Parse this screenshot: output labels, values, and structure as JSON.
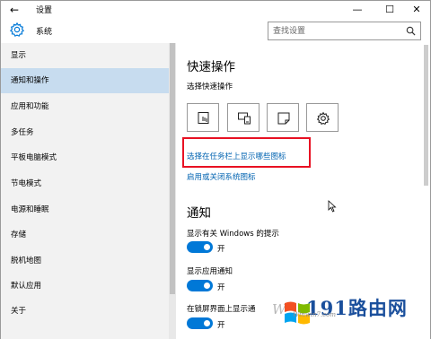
{
  "titlebar": {
    "back_glyph": "←",
    "title": "设置",
    "minimize_glyph": "—",
    "maximize_glyph": "☐",
    "close_glyph": "✕"
  },
  "header": {
    "title": "系统",
    "search_placeholder": "查找设置"
  },
  "sidebar": {
    "items": [
      {
        "label": "显示",
        "active": false
      },
      {
        "label": "通知和操作",
        "active": true
      },
      {
        "label": "应用和功能",
        "active": false
      },
      {
        "label": "多任务",
        "active": false
      },
      {
        "label": "平板电脑模式",
        "active": false
      },
      {
        "label": "节电模式",
        "active": false
      },
      {
        "label": "电源和睡眠",
        "active": false
      },
      {
        "label": "存储",
        "active": false
      },
      {
        "label": "脱机地图",
        "active": false
      },
      {
        "label": "默认应用",
        "active": false
      },
      {
        "label": "关于",
        "active": false
      }
    ]
  },
  "main": {
    "quick_actions_heading": "快速操作",
    "quick_actions_sub": "选择快速操作",
    "quick_action_icons": [
      "tablet-mode-icon",
      "connect-icon",
      "note-icon",
      "settings-icon"
    ],
    "link_taskbar_icons": "选择在任务栏上显示哪些图标",
    "link_system_icons": "启用或关闭系统图标",
    "notifications_heading": "通知",
    "options": [
      {
        "label": "显示有关 Windows 的提示",
        "state": "开"
      },
      {
        "label": "显示应用通知",
        "state": "开"
      },
      {
        "label": "在锁屏界面上显示通",
        "state": "开"
      }
    ]
  },
  "watermark": {
    "brand": "191路由网",
    "site": "Winwin7.com",
    "letter": "W"
  },
  "colors": {
    "accent": "#0078d7",
    "link": "#0063b1",
    "highlight_frame": "#e81123",
    "active_nav": "#c7dcef",
    "sidebar_bg": "#f2f2f2"
  }
}
